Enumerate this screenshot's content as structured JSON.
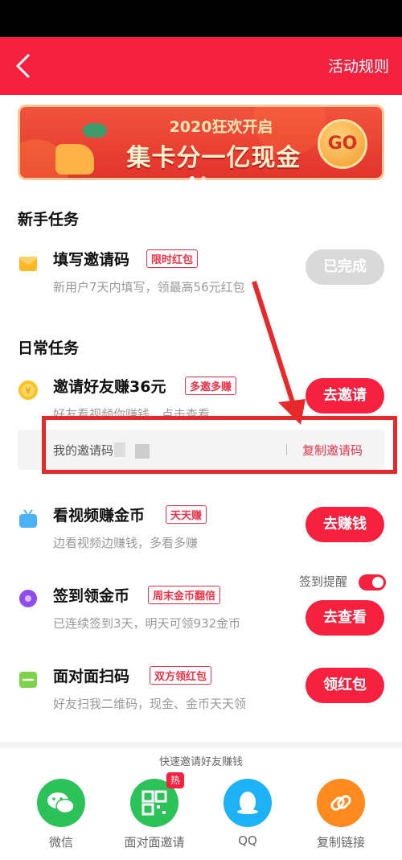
{
  "header": {
    "rules_label": "活动规则"
  },
  "banner": {
    "subtitle": "2020狂欢开启",
    "title": "集卡分一亿现金",
    "go_label": "GO"
  },
  "sections": {
    "newbie": "新手任务",
    "daily": "日常任务"
  },
  "tasks": [
    {
      "title": "填写邀请码",
      "tag": "限时红包",
      "desc": "新用户7天内填写，领最高56元红包",
      "button": "已完成",
      "icon": "envelope-icon"
    },
    {
      "title": "邀请好友赚36元",
      "tag": "多邀多赚",
      "desc": "好友看视频你赚钱，点击查看",
      "button": "去邀请",
      "icon": "coin-icon"
    },
    {
      "title": "看视频赚金币",
      "tag": "天天赚",
      "desc": "边看视频边赚钱，多看多赚",
      "button": "去赚钱",
      "icon": "tv-icon"
    },
    {
      "title": "签到领金币",
      "tag": "周末金币翻倍",
      "desc": "已连续签到3天，明天可领932金币",
      "button": "去查看",
      "icon": "location-icon"
    },
    {
      "title": "面对面扫码",
      "tag": "双方领红包",
      "desc": "好友扫我二维码，现金、金币天天领",
      "button": "领红包",
      "icon": "scan-icon"
    }
  ],
  "invite": {
    "label": "我的邀请码",
    "copy_label": "复制邀请码"
  },
  "checkin": {
    "remind_label": "签到提醒",
    "remind_on": true
  },
  "share": {
    "title": "快速邀请好友赚钱",
    "hot_badge": "热",
    "items": [
      {
        "label": "微信",
        "icon": "wechat-icon",
        "color": "#2dc15a"
      },
      {
        "label": "面对面邀请",
        "icon": "qrcode-icon",
        "color": "#2dc15a"
      },
      {
        "label": "QQ",
        "icon": "qq-icon",
        "color": "#1eb1f5"
      },
      {
        "label": "复制链接",
        "icon": "link-icon",
        "color": "#ff8a1f"
      }
    ]
  },
  "colors": {
    "accent": "#f5213f",
    "tag": "#f0354a",
    "done": "#d9d9d9"
  }
}
